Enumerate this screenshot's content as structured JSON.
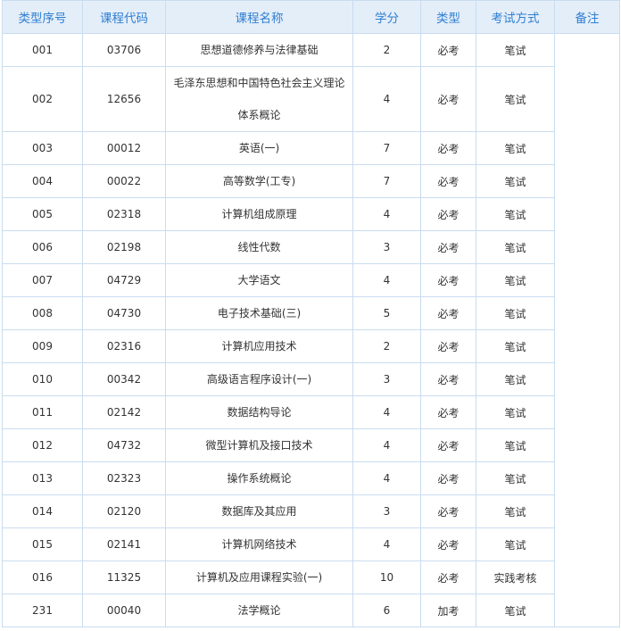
{
  "table": {
    "headers": [
      "类型序号",
      "课程代码",
      "课程名称",
      "学分",
      "类型",
      "考试方式",
      "备注"
    ],
    "rows": [
      {
        "seq": "001",
        "code": "03706",
        "name": "思想道德修养与法律基础",
        "credit": "2",
        "kind": "必考",
        "exam": "笔试"
      },
      {
        "seq": "002",
        "code": "12656",
        "name": "毛泽东思想和中国特色社会主义理论体系概论",
        "credit": "4",
        "kind": "必考",
        "exam": "笔试"
      },
      {
        "seq": "003",
        "code": "00012",
        "name": "英语(一)",
        "credit": "7",
        "kind": "必考",
        "exam": "笔试"
      },
      {
        "seq": "004",
        "code": "00022",
        "name": "高等数学(工专)",
        "credit": "7",
        "kind": "必考",
        "exam": "笔试"
      },
      {
        "seq": "005",
        "code": "02318",
        "name": "计算机组成原理",
        "credit": "4",
        "kind": "必考",
        "exam": "笔试"
      },
      {
        "seq": "006",
        "code": "02198",
        "name": "线性代数",
        "credit": "3",
        "kind": "必考",
        "exam": "笔试"
      },
      {
        "seq": "007",
        "code": "04729",
        "name": "大学语文",
        "credit": "4",
        "kind": "必考",
        "exam": "笔试"
      },
      {
        "seq": "008",
        "code": "04730",
        "name": "电子技术基础(三)",
        "credit": "5",
        "kind": "必考",
        "exam": "笔试"
      },
      {
        "seq": "009",
        "code": "02316",
        "name": "计算机应用技术",
        "credit": "2",
        "kind": "必考",
        "exam": "笔试"
      },
      {
        "seq": "010",
        "code": "00342",
        "name": "高级语言程序设计(一)",
        "credit": "3",
        "kind": "必考",
        "exam": "笔试"
      },
      {
        "seq": "011",
        "code": "02142",
        "name": "数据结构导论",
        "credit": "4",
        "kind": "必考",
        "exam": "笔试"
      },
      {
        "seq": "012",
        "code": "04732",
        "name": "微型计算机及接口技术",
        "credit": "4",
        "kind": "必考",
        "exam": "笔试"
      },
      {
        "seq": "013",
        "code": "02323",
        "name": "操作系统概论",
        "credit": "4",
        "kind": "必考",
        "exam": "笔试"
      },
      {
        "seq": "014",
        "code": "02120",
        "name": "数据库及其应用",
        "credit": "3",
        "kind": "必考",
        "exam": "笔试"
      },
      {
        "seq": "015",
        "code": "02141",
        "name": "计算机网络技术",
        "credit": "4",
        "kind": "必考",
        "exam": "笔试"
      },
      {
        "seq": "016",
        "code": "11325",
        "name": "计算机及应用课程实验(一)",
        "credit": "10",
        "kind": "必考",
        "exam": "实践考核"
      },
      {
        "seq": "231",
        "code": "00040",
        "name": "法学概论",
        "credit": "6",
        "kind": "加考",
        "exam": "笔试"
      }
    ]
  },
  "colors": {
    "header_bg": "#e4eef9",
    "header_text": "#2f7fd1",
    "border": "#c9dcf0",
    "cell_text": "#333333"
  }
}
